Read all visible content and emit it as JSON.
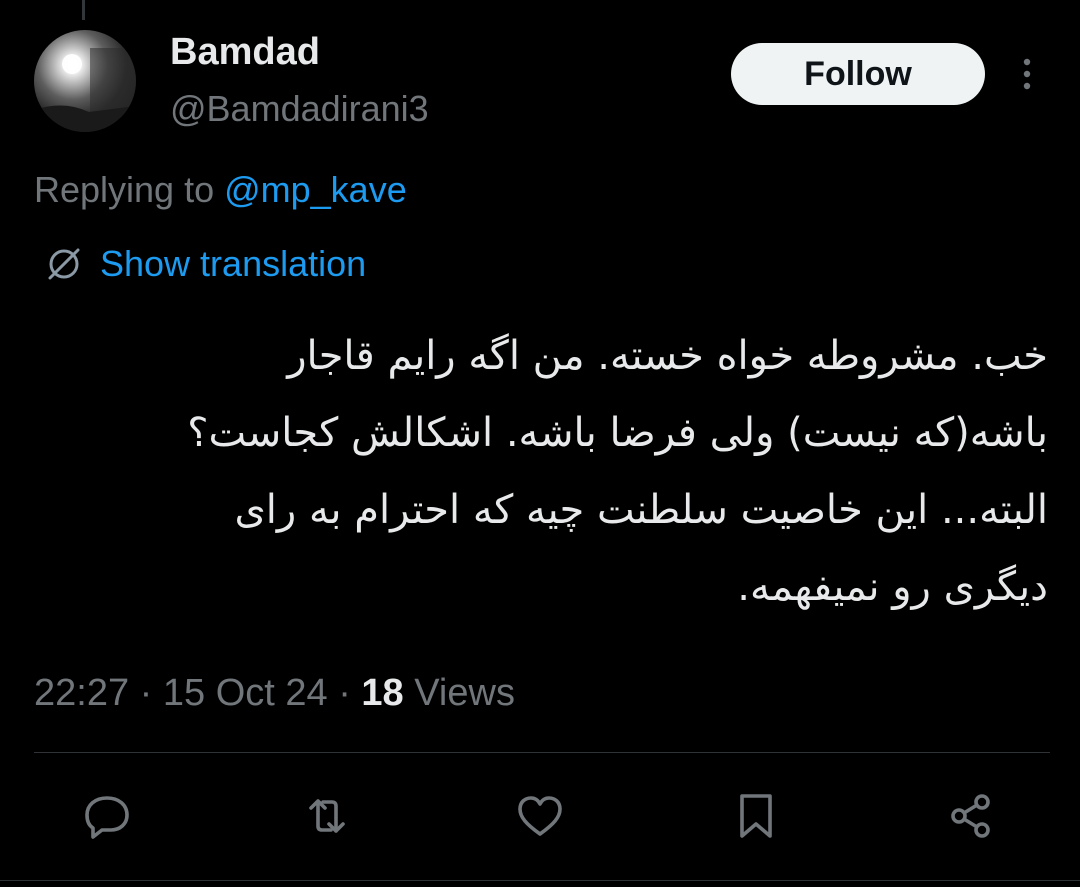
{
  "author": {
    "display_name": "Bamdad",
    "handle": "@Bamdadirani3"
  },
  "header": {
    "follow_label": "Follow",
    "more_icon": "more-vertical-icon"
  },
  "reply": {
    "prefix": "Replying to ",
    "mention": "@mp_kave"
  },
  "translation": {
    "icon": "globe-icon",
    "label": "Show translation"
  },
  "tweet": {
    "text": "خب. مشروطه خواه خسته. من اگه رایم قاجار\nباشه(که نیست) ولی فرضا باشه. اشکالش کجاست؟\nالبته... این خاصیت سلطنت چیه که احترام به رای\nدیگری رو نمیفهمه."
  },
  "meta": {
    "time": "22:27",
    "separator1": " · ",
    "date": "15 Oct 24",
    "separator2": " · ",
    "views_count": "18",
    "views_label": " Views"
  },
  "actions": [
    {
      "icon": "reply-icon"
    },
    {
      "icon": "retweet-icon"
    },
    {
      "icon": "like-icon"
    },
    {
      "icon": "bookmark-icon"
    },
    {
      "icon": "share-icon"
    }
  ],
  "colors": {
    "background": "#000000",
    "accent": "#1d9bf0",
    "text_primary": "#e7e9ea",
    "text_secondary": "#71767b",
    "follow_bg": "#eff3f4"
  }
}
